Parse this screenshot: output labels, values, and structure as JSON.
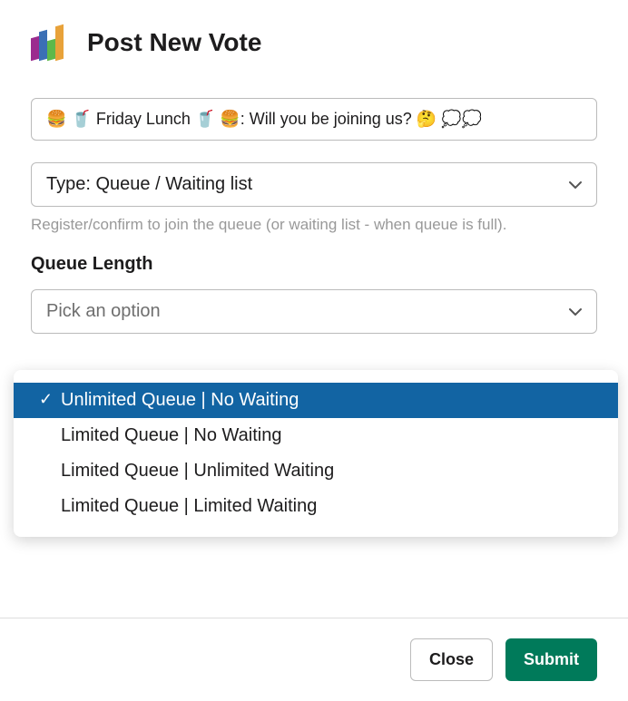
{
  "header": {
    "title": "Post New Vote"
  },
  "topic_input": {
    "value": "🍔 🥤 Friday Lunch 🥤 🍔: Will you be joining us? 🤔 💭💭"
  },
  "type_select": {
    "value": "Type: Queue / Waiting list",
    "helper": "Register/confirm to join the queue (or waiting list - when queue is full)."
  },
  "queue_length": {
    "label": "Queue Length",
    "placeholder": "Pick an option",
    "options": [
      {
        "label": "Unlimited Queue | No Waiting",
        "selected": true
      },
      {
        "label": "Limited Queue | No Waiting",
        "selected": false
      },
      {
        "label": "Limited Queue | Unlimited Waiting",
        "selected": false
      },
      {
        "label": "Limited Queue | Limited Waiting",
        "selected": false
      }
    ]
  },
  "footer": {
    "close": "Close",
    "submit": "Submit"
  }
}
